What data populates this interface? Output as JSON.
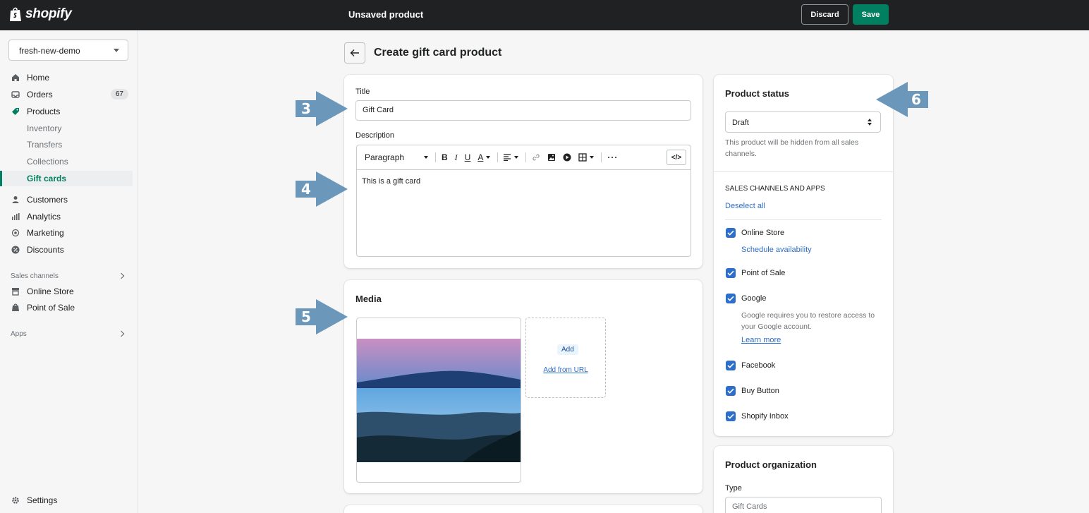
{
  "topbar": {
    "logo_text": "shopify",
    "title": "Unsaved product",
    "discard_label": "Discard",
    "save_label": "Save"
  },
  "colors": {
    "topbar_bg": "#202123",
    "primary_green": "#008060",
    "link_blue": "#2c6ecb",
    "callout_blue": "#6b98ba"
  },
  "sidebar": {
    "store": "fresh-new-demo",
    "items": [
      {
        "label": "Home",
        "icon": "home-icon"
      },
      {
        "label": "Orders",
        "icon": "orders-icon",
        "badge": "67"
      },
      {
        "label": "Products",
        "icon": "tag-icon"
      },
      {
        "label": "Inventory"
      },
      {
        "label": "Transfers"
      },
      {
        "label": "Collections"
      },
      {
        "label": "Gift cards"
      },
      {
        "label": "Customers",
        "icon": "person-icon"
      },
      {
        "label": "Analytics",
        "icon": "bar-chart-icon"
      },
      {
        "label": "Marketing",
        "icon": "target-icon"
      },
      {
        "label": "Discounts",
        "icon": "discount-icon"
      }
    ],
    "sales_channels_label": "Sales channels",
    "channels": [
      {
        "label": "Online Store",
        "icon": "store-icon"
      },
      {
        "label": "Point of Sale",
        "icon": "pos-icon"
      }
    ],
    "apps_label": "Apps",
    "settings_label": "Settings"
  },
  "page": {
    "title": "Create gift card product"
  },
  "product_card": {
    "title_label": "Title",
    "title_value": "Gift Card",
    "description_label": "Description",
    "toolbar_paragraph": "Paragraph",
    "description_value": "This is a gift card"
  },
  "media_card": {
    "heading": "Media",
    "add_label": "Add",
    "add_url_label": "Add from URL"
  },
  "status_card": {
    "heading": "Product status",
    "selected": "Draft",
    "help": "This product will be hidden from all sales channels.",
    "channels_heading": "SALES CHANNELS AND APPS",
    "deselect_all": "Deselect all",
    "online_store": "Online Store",
    "schedule": "Schedule availability",
    "pos": "Point of Sale",
    "google": "Google",
    "google_note": "Google requires you to restore access to your Google account.",
    "learn_more": "Learn more",
    "facebook": "Facebook",
    "buy_button": "Buy Button",
    "shopify_inbox": "Shopify Inbox"
  },
  "org_card": {
    "heading": "Product organization",
    "type_label": "Type",
    "type_value": "Gift Cards"
  },
  "callouts": [
    "3",
    "4",
    "5",
    "6"
  ]
}
